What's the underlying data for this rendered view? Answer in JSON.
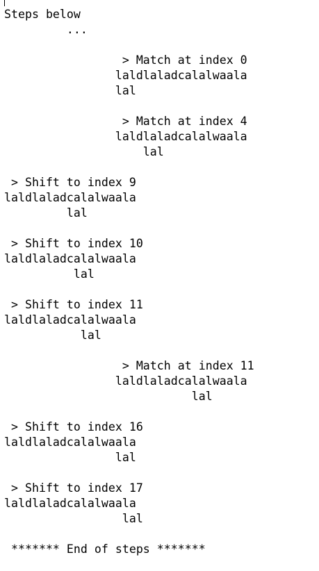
{
  "console": {
    "lines": [
      "Steps below",
      "         ...",
      "",
      "                 > Match at index 0",
      "                laldlaladcalalwaala",
      "                lal",
      "",
      "                 > Match at index 4",
      "                laldlaladcalalwaala",
      "                    lal",
      "",
      " > Shift to index 9",
      "laldlaladcalalwaala",
      "         lal",
      "",
      " > Shift to index 10",
      "laldlaladcalalwaala",
      "          lal",
      "",
      " > Shift to index 11",
      "laldlaladcalalwaala",
      "           lal",
      "",
      "                 > Match at index 11",
      "                laldlaladcalalwaala",
      "                           lal",
      "",
      " > Shift to index 16",
      "laldlaladcalalwaala",
      "                lal",
      "",
      " > Shift to index 17",
      "laldlaladcalalwaala",
      "                 lal",
      "",
      " ******* End of steps *******"
    ]
  }
}
